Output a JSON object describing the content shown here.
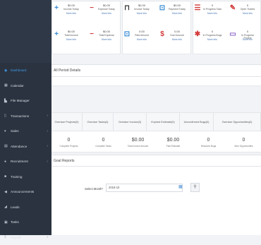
{
  "sidebar": {
    "items": [
      {
        "label": "Dashboard",
        "icon": "dashboard-icon",
        "glyph": "◉",
        "active": true,
        "chevron": false
      },
      {
        "label": "Calendar",
        "icon": "calendar-icon",
        "glyph": "▦",
        "active": false,
        "chevron": false
      },
      {
        "label": "File Manager",
        "icon": "folder-icon",
        "glyph": "▙",
        "active": false,
        "chevron": false
      },
      {
        "label": "Transactions",
        "icon": "transactions-icon",
        "glyph": "▯",
        "active": false,
        "chevron": true
      },
      {
        "label": "Sales",
        "icon": "sales-icon",
        "glyph": "▾",
        "active": false,
        "chevron": true
      },
      {
        "label": "Attendance",
        "icon": "attendance-icon",
        "glyph": "▤",
        "active": false,
        "chevron": true
      },
      {
        "label": "Recruitment",
        "icon": "recruitment-icon",
        "glyph": "●",
        "active": false,
        "chevron": true
      },
      {
        "label": "Training",
        "icon": "training-icon",
        "glyph": "■",
        "active": false,
        "chevron": false
      },
      {
        "label": "Announcements",
        "icon": "announcement-icon",
        "glyph": "◀",
        "active": false,
        "chevron": false
      },
      {
        "label": "Leads",
        "icon": "leads-icon",
        "glyph": "◢",
        "active": false,
        "chevron": false
      },
      {
        "label": "Tasks",
        "icon": "tasks-icon",
        "glyph": "▣",
        "active": false,
        "chevron": false
      },
      {
        "label": "Payroll",
        "icon": "payroll-icon",
        "glyph": "$",
        "active": false,
        "chevron": true
      }
    ]
  },
  "stats": {
    "more_label": "More Info",
    "items": [
      {
        "value": "$0.00",
        "label": "Income Today",
        "icon": "plus-icon",
        "glyph": "+",
        "color": "#2f86d3"
      },
      {
        "value": "$0.00",
        "label": "Expense Today",
        "icon": "minus-icon",
        "glyph": "−",
        "color": "#d23a3a"
      },
      {
        "value": "$0.00",
        "label": "Invoice Today",
        "icon": "cart-icon",
        "glyph": "⊓",
        "color": "#333333"
      },
      {
        "value": "$0.00",
        "label": "Payment Today",
        "icon": "payment-icon",
        "glyph": "⊡",
        "color": "#2f86d3"
      },
      {
        "value": "0",
        "label": "In Progress Task",
        "icon": "task-list-icon",
        "glyph": "☰",
        "color": "#d23a3a"
      },
      {
        "value": "0",
        "label": "Open Tickets",
        "icon": "ticket-icon",
        "glyph": "✎",
        "color": "#d23a3a"
      },
      {
        "value": "$0.00",
        "label": "Total Income",
        "icon": "plus-icon",
        "glyph": "+",
        "color": "#2f86d3"
      },
      {
        "value": "$0.00",
        "label": "Total Expense",
        "icon": "minus-icon",
        "glyph": "−",
        "color": "#d23a3a"
      },
      {
        "value": "0.00",
        "label": "Paid Amount",
        "icon": "paid-icon",
        "glyph": "⊡",
        "color": "#2f86d3"
      },
      {
        "value": "0.00",
        "label": "Due Amount",
        "icon": "dollar-icon",
        "glyph": "$",
        "color": "#d23a3a"
      },
      {
        "value": "0",
        "label": "In Progress Bugs",
        "icon": "bug-icon",
        "glyph": "✱",
        "color": "#d23a3a"
      },
      {
        "value": "0",
        "label": "In Progress Project",
        "icon": "project-icon",
        "glyph": "▭",
        "color": "#8a63c7"
      }
    ]
  },
  "all_period": {
    "title": "All Period Details"
  },
  "tabs": [
    {
      "label": "Overdue Projects(0)"
    },
    {
      "label": "Overdue Tasks(0)"
    },
    {
      "label": "Overdue Invoice(0)"
    },
    {
      "label": "Expired Estimate(0)"
    },
    {
      "label": "Unconfirmed Bugs(0)"
    },
    {
      "label": "Overdue Opportunities(0)"
    }
  ],
  "counts": [
    {
      "value": "0",
      "label": "Complete Projects"
    },
    {
      "value": "0",
      "label": "Complete Tasks"
    },
    {
      "value": "$0.00",
      "label": "Total Invoice Amount"
    },
    {
      "value": "$0.00",
      "label": "Paid Estimate"
    },
    {
      "value": "0",
      "label": "Resolved Bugs"
    },
    {
      "value": "0",
      "label": "Won Opportunities"
    }
  ],
  "goal": {
    "title": "Goal Reports",
    "month_label": "Select Month*",
    "month_value": "2018-10"
  },
  "icons": {
    "calendar": "▦",
    "search": "⚲"
  }
}
